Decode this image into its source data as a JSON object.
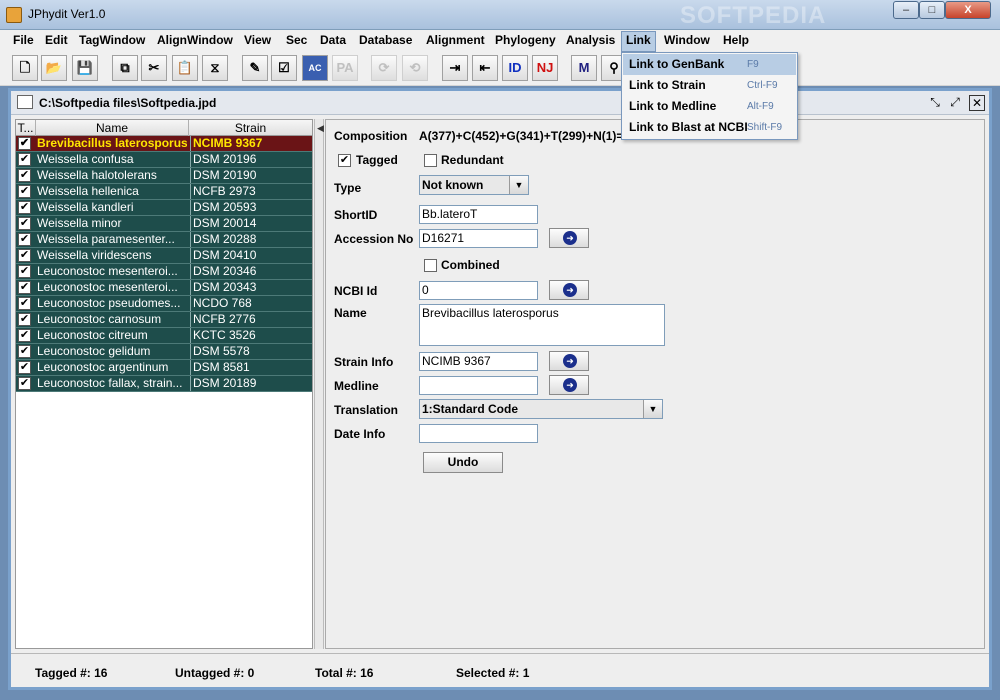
{
  "window": {
    "title": "JPhydit Ver1.0",
    "watermark": "SOFTPEDIA",
    "minimize": "–",
    "maximize": "□",
    "close": "X"
  },
  "menubar": [
    "File",
    "Edit",
    "TagWindow",
    "AlignWindow",
    "View",
    "Sec",
    "Data",
    "Database",
    "Alignment",
    "Phylogeny",
    "Analysis",
    "Link",
    "Window",
    "Help"
  ],
  "toolbar": [
    {
      "name": "new-file-icon",
      "glyph": "🗋"
    },
    {
      "name": "open-folder-icon",
      "glyph": "📂"
    },
    {
      "name": "save-icon",
      "glyph": "💾"
    },
    {
      "name": "copy-icon",
      "glyph": "⧉"
    },
    {
      "name": "cut-icon",
      "glyph": "✂"
    },
    {
      "name": "paste-icon",
      "glyph": "📋"
    },
    {
      "name": "tag-icon",
      "glyph": "⧖"
    },
    {
      "name": "edit-icon",
      "glyph": "✎"
    },
    {
      "name": "checklist-icon",
      "glyph": "☑"
    },
    {
      "name": "actg-icon",
      "glyph": "AC"
    },
    {
      "name": "pa-icon",
      "glyph": "PA"
    },
    {
      "name": "refresh-icon",
      "glyph": "⟳"
    },
    {
      "name": "reload-icon",
      "glyph": "⟲"
    },
    {
      "name": "import-icon",
      "glyph": "⇥"
    },
    {
      "name": "export-icon",
      "glyph": "⇤"
    },
    {
      "name": "id-icon",
      "glyph": "ID"
    },
    {
      "name": "nj-icon",
      "glyph": "NJ"
    },
    {
      "name": "m-icon",
      "glyph": "M"
    },
    {
      "name": "binoculars-icon",
      "glyph": "⚲"
    }
  ],
  "frame": {
    "title": "C:\\Softpedia files\\Softpedia.jpd"
  },
  "list": {
    "headers": [
      "T...",
      "Name",
      "Strain"
    ],
    "rows": [
      {
        "name": "Brevibacillus laterosporus",
        "strain": "NCIMB 9367",
        "selected": true
      },
      {
        "name": "Weissella confusa",
        "strain": "DSM 20196"
      },
      {
        "name": "Weissella halotolerans",
        "strain": "DSM 20190"
      },
      {
        "name": "Weissella hellenica",
        "strain": "NCFB 2973"
      },
      {
        "name": "Weissella kandleri",
        "strain": "DSM 20593"
      },
      {
        "name": "Weissella minor",
        "strain": "DSM 20014"
      },
      {
        "name": "Weissella paramesenter...",
        "strain": "DSM 20288"
      },
      {
        "name": "Weissella viridescens",
        "strain": "DSM 20410"
      },
      {
        "name": "Leuconostoc mesenteroi...",
        "strain": "DSM 20346"
      },
      {
        "name": "Leuconostoc mesenteroi...",
        "strain": "DSM 20343"
      },
      {
        "name": "Leuconostoc pseudomes...",
        "strain": "NCDO 768"
      },
      {
        "name": "Leuconostoc carnosum",
        "strain": "NCFB 2776"
      },
      {
        "name": "Leuconostoc citreum",
        "strain": "KCTC 3526"
      },
      {
        "name": "Leuconostoc gelidum",
        "strain": "DSM 5578"
      },
      {
        "name": "Leuconostoc argentinum",
        "strain": "DSM 8581"
      },
      {
        "name": "Leuconostoc fallax, strain...",
        "strain": "DSM 20189"
      }
    ]
  },
  "detail": {
    "composition_label": "Composition",
    "composition_value": "A(377)+C(452)+G(341)+T(299)+N(1)=",
    "tagged_label": "Tagged",
    "redundant_label": "Redundant",
    "type_label": "Type",
    "type_value": "Not known",
    "shortid_label": "ShortID",
    "shortid_value": "Bb.lateroT",
    "accession_label": "Accession No",
    "accession_value": "D16271",
    "combined_label": "Combined",
    "ncbi_label": "NCBI Id",
    "ncbi_value": "0",
    "name_label": "Name",
    "name_value": "Brevibacillus laterosporus",
    "strain_label": "Strain Info",
    "strain_value": "NCIMB 9367",
    "medline_label": "Medline",
    "medline_value": "",
    "translation_label": "Translation",
    "translation_value": "1:Standard Code",
    "date_label": "Date Info",
    "date_value": "",
    "undo_label": "Undo"
  },
  "status": {
    "tagged": "Tagged #: 16",
    "untagged": "Untagged #: 0",
    "total": "Total #: 16",
    "selected": "Selected #: 1"
  },
  "link_menu": [
    {
      "label": "Link to GenBank",
      "key": "F9"
    },
    {
      "label": "Link to Strain",
      "key": "Ctrl-F9"
    },
    {
      "label": "Link to Medline",
      "key": "Alt-F9"
    },
    {
      "label": "Link to Blast at NCBI",
      "key": "Shift-F9"
    }
  ],
  "colors": {
    "row_bg": "#1e4d4b",
    "row_selected_bg": "#6a1416",
    "row_selected_fg": "#ffe600",
    "frame_border": "#7aa1cc",
    "menu_highlight": "#b8cde4"
  }
}
